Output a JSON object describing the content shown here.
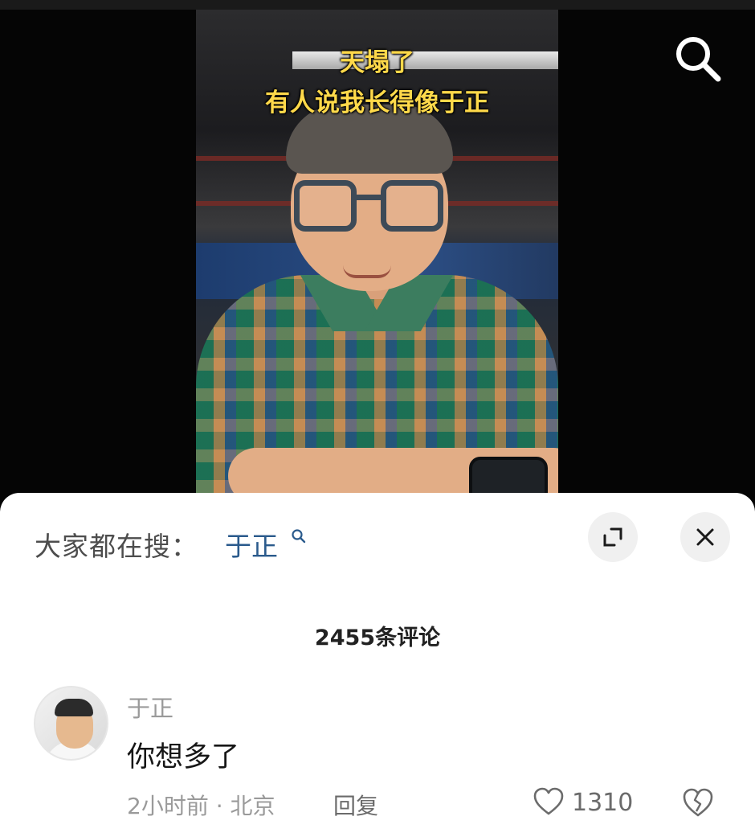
{
  "video": {
    "caption_line1": "天塌了",
    "caption_line2": "有人说我长得像于正",
    "caption_color": "#ffd94a"
  },
  "header": {
    "search_icon": "search-icon"
  },
  "sheet": {
    "trending_label": "大家都在搜：",
    "trending_term": "于正",
    "trending_term_color": "#2a5a8c",
    "expand_icon": "expand-icon",
    "close_icon": "close-icon",
    "comment_count": "2455条评论"
  },
  "comment": {
    "author": "于正",
    "text": "你想多了",
    "meta": "2小时前 · 北京",
    "reply_label": "回复",
    "like_count": "1310",
    "like_icon": "heart-outline-icon",
    "dislike_icon": "broken-heart-icon"
  }
}
